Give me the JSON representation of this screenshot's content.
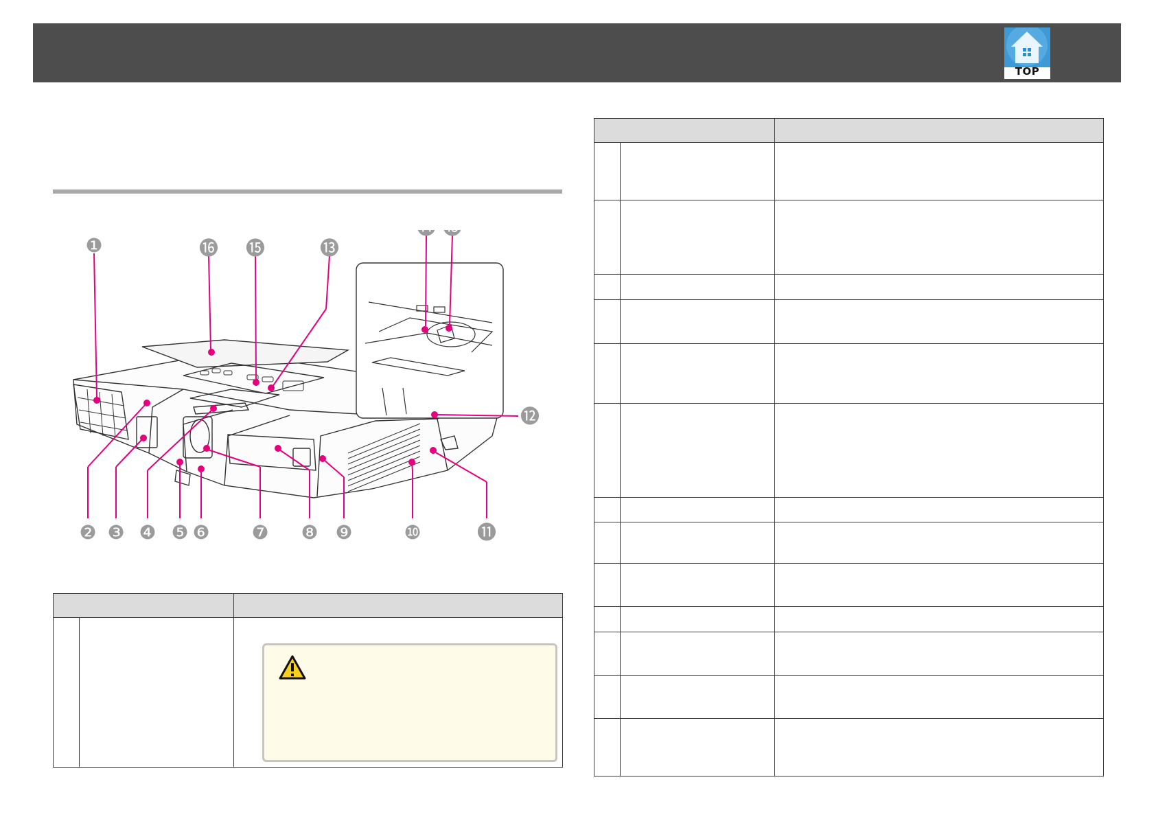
{
  "header": {
    "logo_label": "TOP",
    "colors": {
      "bar": "#4d4d4d",
      "logo_blue": "#2a8fd0"
    },
    "logo_icon": "house-icon"
  },
  "diagram": {
    "callout_color": "#e6007e",
    "callout_numbers": [
      "❶",
      "❷",
      "❸",
      "❹",
      "❺",
      "❻",
      "❼",
      "❽",
      "❾",
      "❿",
      "⓫",
      "⓬",
      "⓭",
      "⓮",
      "⓯",
      "⓰"
    ]
  },
  "caution": {
    "icon": "warning-triangle-icon"
  },
  "tables": {
    "left_rows": 1,
    "right_rows": 14
  }
}
